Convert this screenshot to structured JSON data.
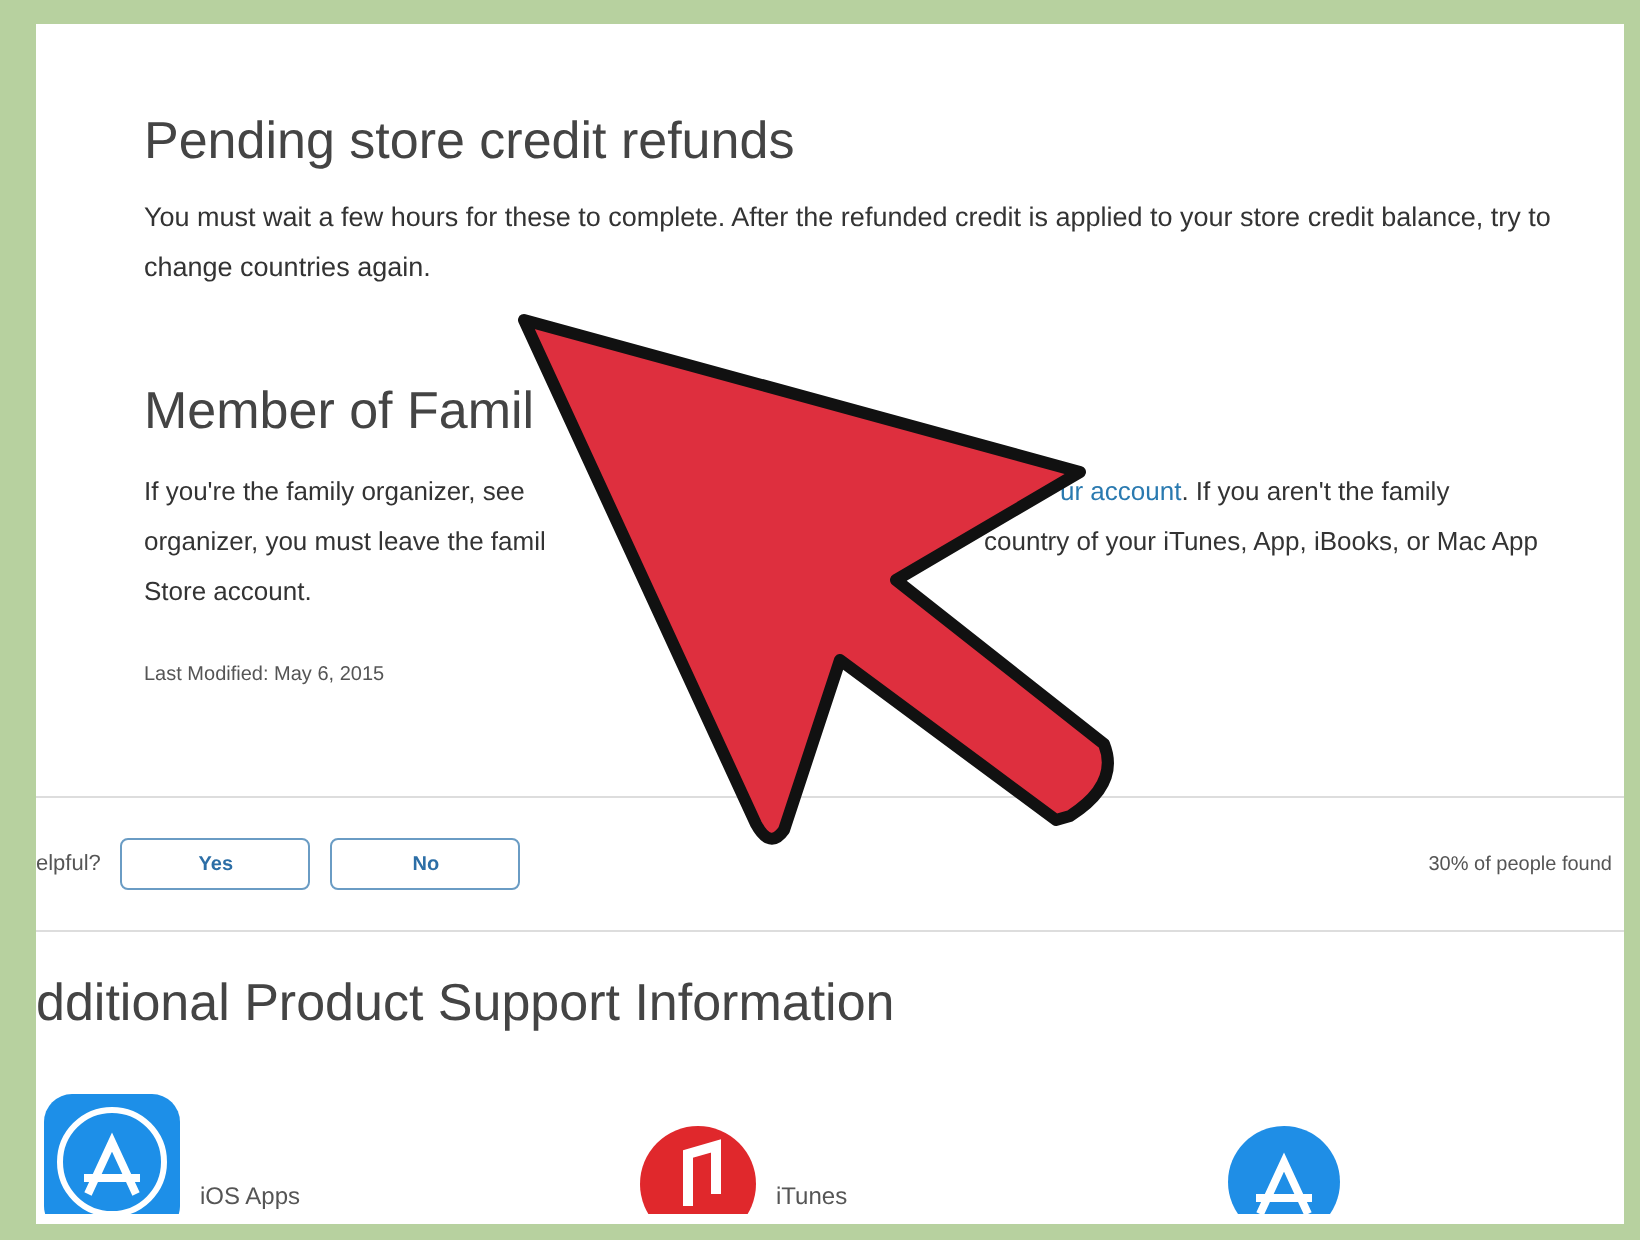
{
  "pending": {
    "heading": "Pending store credit refunds",
    "text": "You must wait a few hours for these to complete. After the refunded credit is applied to your store credit balance, try to change countries again."
  },
  "family": {
    "heading": "Member of Famil",
    "lines": [
      [
        {
          "text": "If you're the family organizer, see",
          "kind": "text",
          "covered_before": false
        },
        {
          "text": "ur account",
          "kind": "link",
          "covered_before": true
        },
        {
          "text": ". If you aren't the family",
          "kind": "text",
          "covered_before": false
        }
      ],
      [
        {
          "text": "organizer, you must leave the famil",
          "kind": "text",
          "covered_before": false
        },
        {
          "text": "country of your iTunes, App, iBooks, or Mac App",
          "kind": "text",
          "covered_before": true
        }
      ],
      [
        {
          "text": "Store account.",
          "kind": "text",
          "covered_before": false
        }
      ]
    ]
  },
  "modified": "Last Modified: May 6, 2015",
  "feedback": {
    "question": "elpful?",
    "buttons": [
      {
        "label": "Yes"
      },
      {
        "label": "No"
      }
    ],
    "stat": "30% of people found"
  },
  "more": {
    "heading": "dditional Product Support Information",
    "items": [
      {
        "label": "iOS Apps",
        "kind": "app-store"
      },
      {
        "label": "iTunes",
        "kind": "music"
      },
      {
        "kind": "app-store-round"
      }
    ]
  }
}
